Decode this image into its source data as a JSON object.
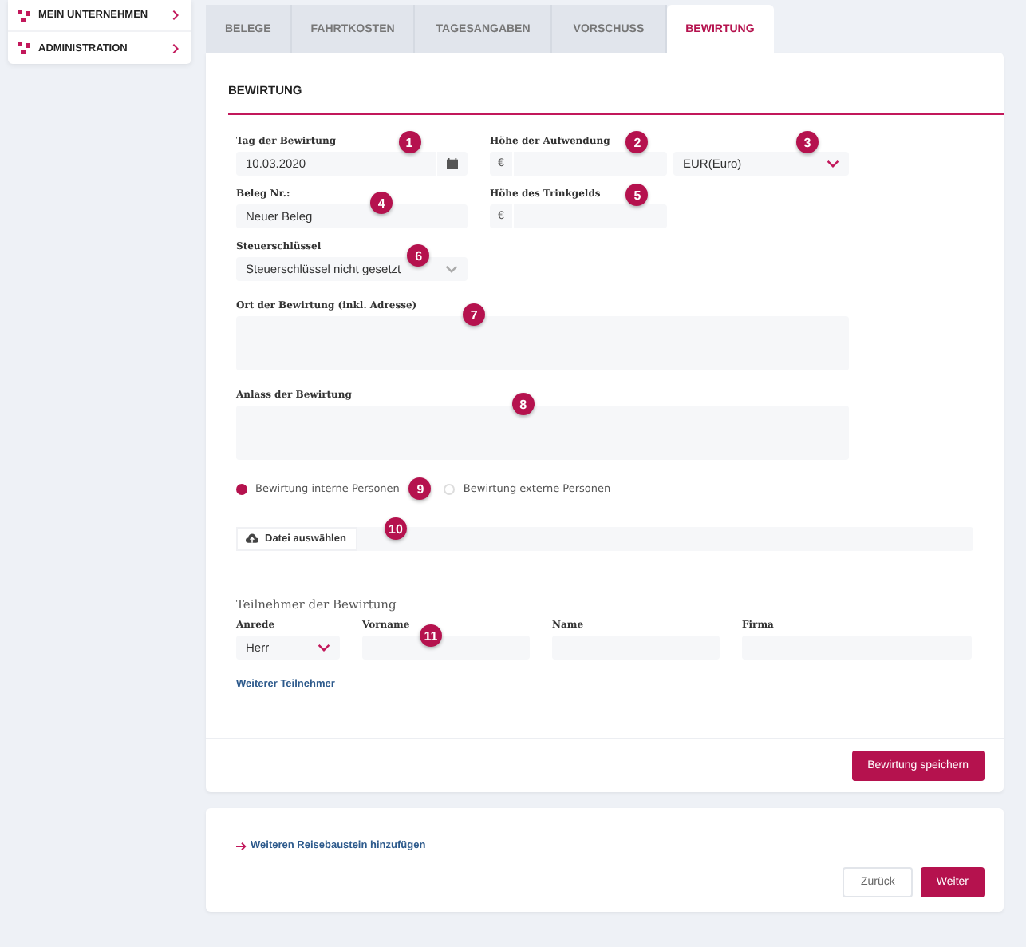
{
  "sidebar": {
    "items": [
      {
        "label": "MEIN UNTERNEHMEN"
      },
      {
        "label": "ADMINISTRATION"
      }
    ]
  },
  "tabs": [
    {
      "label": "BELEGE",
      "selected": false
    },
    {
      "label": "FAHRTKOSTEN",
      "selected": false
    },
    {
      "label": "TAGESANGABEN",
      "selected": false
    },
    {
      "label": "VORSCHUSS",
      "selected": false
    },
    {
      "label": "BEWIRTUNG",
      "selected": true
    }
  ],
  "section_title": "BEWIRTUNG",
  "rows": [
    [
      {
        "kind": "date",
        "label": "Tag der Bewirtung",
        "value": "10.03.2020",
        "marker": "1"
      },
      {
        "kind": "amount",
        "label": "Höhe der Aufwendung",
        "prefix": "€",
        "marker": "2"
      },
      {
        "kind": "currency",
        "value": "EUR(Euro)",
        "marker": "3"
      }
    ],
    [
      {
        "kind": "text",
        "label": "Beleg Nr.:",
        "value": "Neuer Beleg",
        "marker": "4"
      },
      {
        "kind": "amount",
        "label": "Höhe des Trinkgelds",
        "prefix": "€",
        "marker": "5"
      }
    ],
    [
      {
        "kind": "select",
        "label": "Steuerschlüssel",
        "value": "Steuerschlüssel nicht gesetzt",
        "marker": "6"
      }
    ],
    [
      {
        "kind": "textarea",
        "label": "Ort der Bewirtung (inkl. Adresse)",
        "marker": "7"
      }
    ],
    [
      {
        "kind": "textarea",
        "label": "Anlass der Bewirtung",
        "marker": "8"
      }
    ]
  ],
  "radios": {
    "marker": "9",
    "options": [
      {
        "label": "Bewirtung interne Personen",
        "selected": true
      },
      {
        "label": "Bewirtung externe Personen",
        "selected": false
      }
    ]
  },
  "file_upload": {
    "button": "Datei auswählen",
    "marker": "10"
  },
  "participants": {
    "title": "Teilnehmer der Bewirtung",
    "add_link": "Weiterer Teilnehmer",
    "columns": [
      {
        "kind": "select",
        "label": "Anrede",
        "value": "Herr"
      },
      {
        "kind": "text",
        "label": "Vorname",
        "marker": "11"
      },
      {
        "kind": "text",
        "label": "Name"
      },
      {
        "kind": "text",
        "label": "Firma"
      }
    ]
  },
  "save_button": "Bewirtung speichern",
  "footer": {
    "add_link": "Weiteren Reisebaustein hinzufügen",
    "buttons": [
      {
        "kind": "secondary",
        "label": "Zurück"
      },
      {
        "kind": "primary",
        "label": "Weiter"
      }
    ]
  }
}
